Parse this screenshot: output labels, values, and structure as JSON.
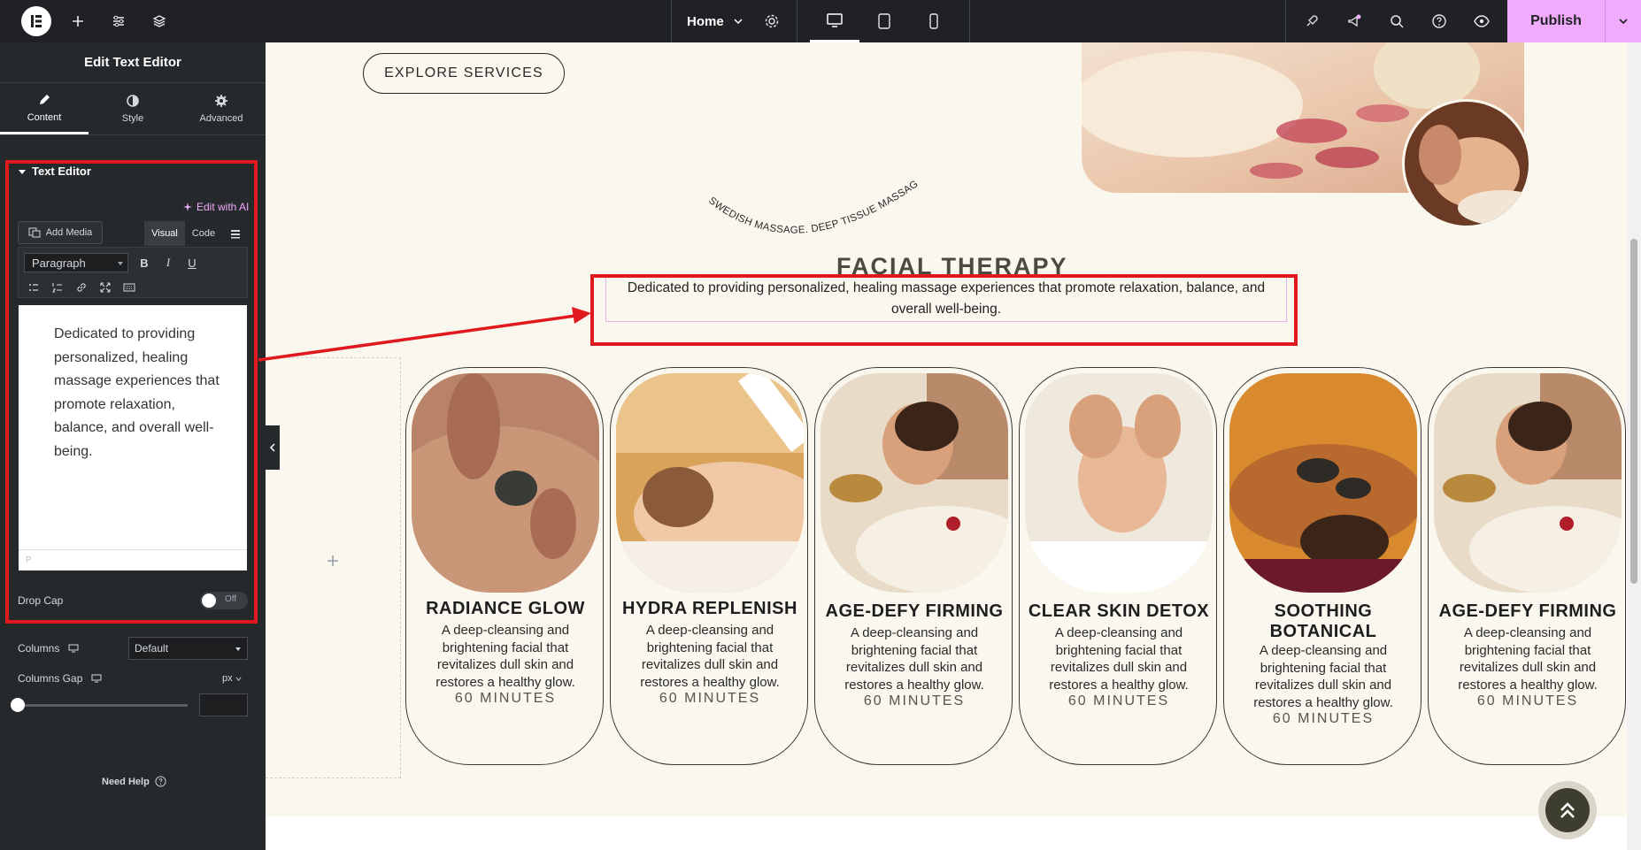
{
  "topbar": {
    "page_name": "Home",
    "publish_label": "Publish"
  },
  "panel": {
    "title": "Edit Text Editor",
    "tabs": [
      {
        "label": "Content",
        "icon": "pencil-icon"
      },
      {
        "label": "Style",
        "icon": "half-circle-icon"
      },
      {
        "label": "Advanced",
        "icon": "gear-icon"
      }
    ],
    "section_title": "Text Editor",
    "edit_with_ai": "Edit with AI",
    "add_media": "Add Media",
    "mode_visual": "Visual",
    "mode_code": "Code",
    "paragraph_format": "Paragraph",
    "editor_content": "Dedicated to providing personalized, healing massage experiences that promote relaxation, balance, and overall well-being.",
    "editor_status": "P",
    "drop_cap_label": "Drop Cap",
    "drop_cap_state": "Off",
    "columns_label": "Columns",
    "columns_value": "Default",
    "columns_gap_label": "Columns Gap",
    "columns_gap_unit": "px",
    "need_help": "Need Help"
  },
  "canvas": {
    "explore_button": "EXPLORE SERVICES",
    "curved_text": "SWEDISH MASSAGE. DEEP TISSUE MASSAGE. HOT ST",
    "section_title": "FACIAL THERAPY",
    "description": "Dedicated to providing personalized, healing massage experiences that promote relaxation, balance, and overall well-being.",
    "cards": [
      {
        "title": "RADIANCE GLOW",
        "desc": "A deep-cleansing and brightening facial that revitalizes dull skin and restores a healthy glow.",
        "duration": "60 MINUTES"
      },
      {
        "title": "HYDRA REPLENISH",
        "desc": "A deep-cleansing and brightening facial that revitalizes dull skin and restores a healthy glow.",
        "duration": "60 MINUTES"
      },
      {
        "title": "AGE-DEFY FIRMING",
        "desc": "A deep-cleansing and brightening facial that revitalizes dull skin and restores a healthy glow.",
        "duration": "60 MINUTES"
      },
      {
        "title": "CLEAR SKIN DETOX",
        "desc": "A deep-cleansing and brightening facial that revitalizes dull skin and restores a healthy glow.",
        "duration": "60 MINUTES"
      },
      {
        "title": "SOOTHING BOTANICAL",
        "desc": "A deep-cleansing and brightening facial that revitalizes dull skin and restores a healthy glow.",
        "duration": "60 MINUTES"
      },
      {
        "title": "AGE-DEFY FIRMING",
        "desc": "A deep-cleansing and brightening facial that revitalizes dull skin and restores a healthy glow.",
        "duration": "60 MINUTES"
      }
    ]
  },
  "colors": {
    "accent": "#f0abfc",
    "highlight": "#e0191e",
    "panel_bg": "#26292c",
    "canvas_bg": "#faf7ee"
  }
}
